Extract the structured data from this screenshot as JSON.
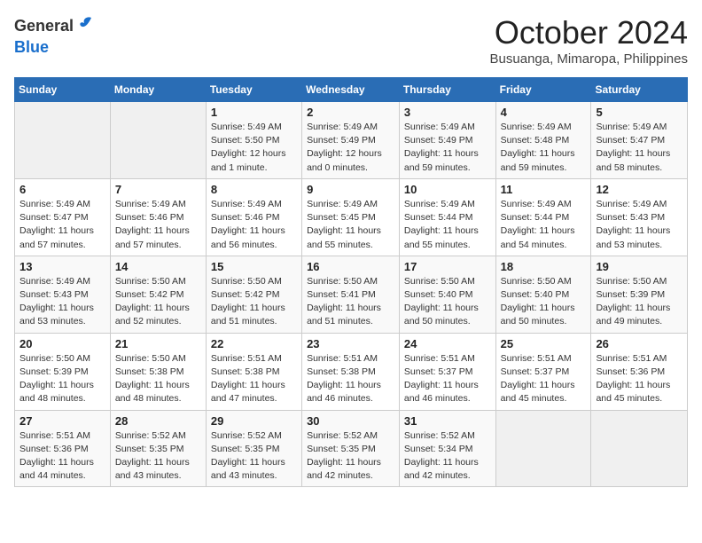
{
  "header": {
    "logo_general": "General",
    "logo_blue": "Blue",
    "month": "October 2024",
    "location": "Busuanga, Mimaropa, Philippines"
  },
  "weekdays": [
    "Sunday",
    "Monday",
    "Tuesday",
    "Wednesday",
    "Thursday",
    "Friday",
    "Saturday"
  ],
  "weeks": [
    [
      {
        "day": "",
        "detail": ""
      },
      {
        "day": "",
        "detail": ""
      },
      {
        "day": "1",
        "detail": "Sunrise: 5:49 AM\nSunset: 5:50 PM\nDaylight: 12 hours\nand 1 minute."
      },
      {
        "day": "2",
        "detail": "Sunrise: 5:49 AM\nSunset: 5:49 PM\nDaylight: 12 hours\nand 0 minutes."
      },
      {
        "day": "3",
        "detail": "Sunrise: 5:49 AM\nSunset: 5:49 PM\nDaylight: 11 hours\nand 59 minutes."
      },
      {
        "day": "4",
        "detail": "Sunrise: 5:49 AM\nSunset: 5:48 PM\nDaylight: 11 hours\nand 59 minutes."
      },
      {
        "day": "5",
        "detail": "Sunrise: 5:49 AM\nSunset: 5:47 PM\nDaylight: 11 hours\nand 58 minutes."
      }
    ],
    [
      {
        "day": "6",
        "detail": "Sunrise: 5:49 AM\nSunset: 5:47 PM\nDaylight: 11 hours\nand 57 minutes."
      },
      {
        "day": "7",
        "detail": "Sunrise: 5:49 AM\nSunset: 5:46 PM\nDaylight: 11 hours\nand 57 minutes."
      },
      {
        "day": "8",
        "detail": "Sunrise: 5:49 AM\nSunset: 5:46 PM\nDaylight: 11 hours\nand 56 minutes."
      },
      {
        "day": "9",
        "detail": "Sunrise: 5:49 AM\nSunset: 5:45 PM\nDaylight: 11 hours\nand 55 minutes."
      },
      {
        "day": "10",
        "detail": "Sunrise: 5:49 AM\nSunset: 5:44 PM\nDaylight: 11 hours\nand 55 minutes."
      },
      {
        "day": "11",
        "detail": "Sunrise: 5:49 AM\nSunset: 5:44 PM\nDaylight: 11 hours\nand 54 minutes."
      },
      {
        "day": "12",
        "detail": "Sunrise: 5:49 AM\nSunset: 5:43 PM\nDaylight: 11 hours\nand 53 minutes."
      }
    ],
    [
      {
        "day": "13",
        "detail": "Sunrise: 5:49 AM\nSunset: 5:43 PM\nDaylight: 11 hours\nand 53 minutes."
      },
      {
        "day": "14",
        "detail": "Sunrise: 5:50 AM\nSunset: 5:42 PM\nDaylight: 11 hours\nand 52 minutes."
      },
      {
        "day": "15",
        "detail": "Sunrise: 5:50 AM\nSunset: 5:42 PM\nDaylight: 11 hours\nand 51 minutes."
      },
      {
        "day": "16",
        "detail": "Sunrise: 5:50 AM\nSunset: 5:41 PM\nDaylight: 11 hours\nand 51 minutes."
      },
      {
        "day": "17",
        "detail": "Sunrise: 5:50 AM\nSunset: 5:40 PM\nDaylight: 11 hours\nand 50 minutes."
      },
      {
        "day": "18",
        "detail": "Sunrise: 5:50 AM\nSunset: 5:40 PM\nDaylight: 11 hours\nand 50 minutes."
      },
      {
        "day": "19",
        "detail": "Sunrise: 5:50 AM\nSunset: 5:39 PM\nDaylight: 11 hours\nand 49 minutes."
      }
    ],
    [
      {
        "day": "20",
        "detail": "Sunrise: 5:50 AM\nSunset: 5:39 PM\nDaylight: 11 hours\nand 48 minutes."
      },
      {
        "day": "21",
        "detail": "Sunrise: 5:50 AM\nSunset: 5:38 PM\nDaylight: 11 hours\nand 48 minutes."
      },
      {
        "day": "22",
        "detail": "Sunrise: 5:51 AM\nSunset: 5:38 PM\nDaylight: 11 hours\nand 47 minutes."
      },
      {
        "day": "23",
        "detail": "Sunrise: 5:51 AM\nSunset: 5:38 PM\nDaylight: 11 hours\nand 46 minutes."
      },
      {
        "day": "24",
        "detail": "Sunrise: 5:51 AM\nSunset: 5:37 PM\nDaylight: 11 hours\nand 46 minutes."
      },
      {
        "day": "25",
        "detail": "Sunrise: 5:51 AM\nSunset: 5:37 PM\nDaylight: 11 hours\nand 45 minutes."
      },
      {
        "day": "26",
        "detail": "Sunrise: 5:51 AM\nSunset: 5:36 PM\nDaylight: 11 hours\nand 45 minutes."
      }
    ],
    [
      {
        "day": "27",
        "detail": "Sunrise: 5:51 AM\nSunset: 5:36 PM\nDaylight: 11 hours\nand 44 minutes."
      },
      {
        "day": "28",
        "detail": "Sunrise: 5:52 AM\nSunset: 5:35 PM\nDaylight: 11 hours\nand 43 minutes."
      },
      {
        "day": "29",
        "detail": "Sunrise: 5:52 AM\nSunset: 5:35 PM\nDaylight: 11 hours\nand 43 minutes."
      },
      {
        "day": "30",
        "detail": "Sunrise: 5:52 AM\nSunset: 5:35 PM\nDaylight: 11 hours\nand 42 minutes."
      },
      {
        "day": "31",
        "detail": "Sunrise: 5:52 AM\nSunset: 5:34 PM\nDaylight: 11 hours\nand 42 minutes."
      },
      {
        "day": "",
        "detail": ""
      },
      {
        "day": "",
        "detail": ""
      }
    ]
  ]
}
